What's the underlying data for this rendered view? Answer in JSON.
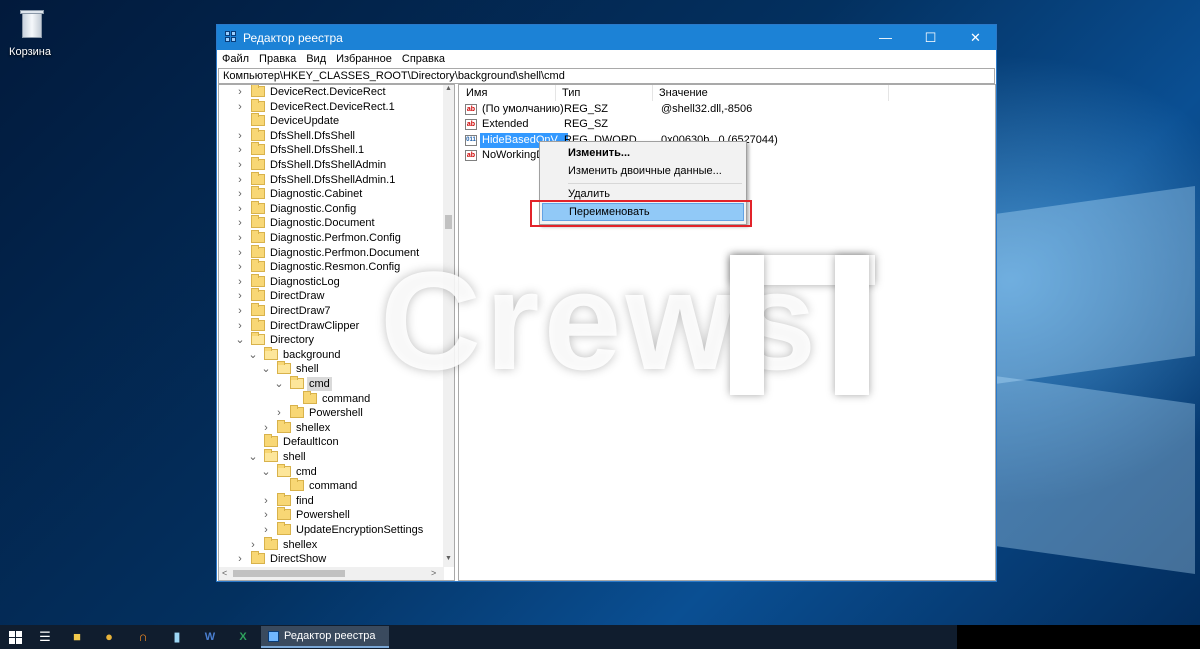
{
  "desktop": {
    "recycle_bin_label": "Корзина"
  },
  "window": {
    "title": "Редактор реестра",
    "controls": {
      "minimize": "—",
      "maximize": "☐",
      "close": "✕"
    },
    "menu": [
      "Файл",
      "Правка",
      "Вид",
      "Избранное",
      "Справка"
    ],
    "address": "Компьютер\\HKEY_CLASSES_ROOT\\Directory\\background\\shell\\cmd"
  },
  "tree": {
    "items": [
      {
        "label": "DeviceRect.DeviceRect",
        "chevron": ">",
        "open": false
      },
      {
        "label": "DeviceRect.DeviceRect.1",
        "chevron": ">",
        "open": false
      },
      {
        "label": "DeviceUpdate",
        "chevron": "",
        "open": false
      },
      {
        "label": "DfsShell.DfsShell",
        "chevron": ">",
        "open": false
      },
      {
        "label": "DfsShell.DfsShell.1",
        "chevron": ">",
        "open": false
      },
      {
        "label": "DfsShell.DfsShellAdmin",
        "chevron": ">",
        "open": false
      },
      {
        "label": "DfsShell.DfsShellAdmin.1",
        "chevron": ">",
        "open": false
      },
      {
        "label": "Diagnostic.Cabinet",
        "chevron": ">",
        "open": false
      },
      {
        "label": "Diagnostic.Config",
        "chevron": ">",
        "open": false
      },
      {
        "label": "Diagnostic.Document",
        "chevron": ">",
        "open": false
      },
      {
        "label": "Diagnostic.Perfmon.Config",
        "chevron": ">",
        "open": false
      },
      {
        "label": "Diagnostic.Perfmon.Document",
        "chevron": ">",
        "open": false
      },
      {
        "label": "Diagnostic.Resmon.Config",
        "chevron": ">",
        "open": false
      },
      {
        "label": "DiagnosticLog",
        "chevron": ">",
        "open": false
      },
      {
        "label": "DirectDraw",
        "chevron": ">",
        "open": false
      },
      {
        "label": "DirectDraw7",
        "chevron": ">",
        "open": false
      },
      {
        "label": "DirectDrawClipper",
        "chevron": ">",
        "open": false
      },
      {
        "label": "Directory",
        "chevron": "v",
        "open": true
      },
      {
        "label": "background",
        "chevron": "v",
        "open": true
      },
      {
        "label": "shell",
        "chevron": "v",
        "open": true
      },
      {
        "label": "cmd",
        "chevron": "v",
        "open": true,
        "selected": true
      },
      {
        "label": "command",
        "chevron": "",
        "open": false
      },
      {
        "label": "Powershell",
        "chevron": ">",
        "open": false
      },
      {
        "label": "shellex",
        "chevron": ">",
        "open": false
      },
      {
        "label": "DefaultIcon",
        "chevron": "",
        "open": false
      },
      {
        "label": "shell",
        "chevron": "v",
        "open": true
      },
      {
        "label": "cmd",
        "chevron": "v",
        "open": true
      },
      {
        "label": "command",
        "chevron": "",
        "open": false
      },
      {
        "label": "find",
        "chevron": ">",
        "open": false
      },
      {
        "label": "Powershell",
        "chevron": ">",
        "open": false
      },
      {
        "label": "UpdateEncryptionSettings",
        "chevron": ">",
        "open": false
      },
      {
        "label": "shellex",
        "chevron": ">",
        "open": false
      },
      {
        "label": "DirectShow",
        "chevron": ">",
        "open": false
      }
    ]
  },
  "values": {
    "headers": {
      "name": "Имя",
      "type": "Тип",
      "data": "Значение"
    },
    "rows": [
      {
        "name": "(По умолчанию)",
        "type": "REG_SZ",
        "data": "@shell32.dll,-8506",
        "icon": "ab"
      },
      {
        "name": "Extended",
        "type": "REG_SZ",
        "data": "",
        "icon": "ab"
      },
      {
        "name": "HideBasedOnV...",
        "type": "REG_DWORD",
        "data": "0x00630b...0 (6527044)",
        "icon": "bin",
        "selected": true
      },
      {
        "name": "NoWorkingDir...",
        "type": "",
        "data": "",
        "icon": "ab"
      }
    ]
  },
  "context_menu": {
    "modify": "Изменить...",
    "modify_binary": "Изменить двоичные данные...",
    "delete": "Удалить",
    "rename": "Переименовать"
  },
  "watermark": {
    "text": "Crews"
  },
  "taskbar": {
    "active_app": "Редактор реестра",
    "icons": [
      "start-icon",
      "task-view-icon",
      "file-explorer-icon",
      "chrome-icon",
      "app-orange-icon",
      "notepad-icon",
      "word-icon",
      "excel-icon"
    ]
  }
}
